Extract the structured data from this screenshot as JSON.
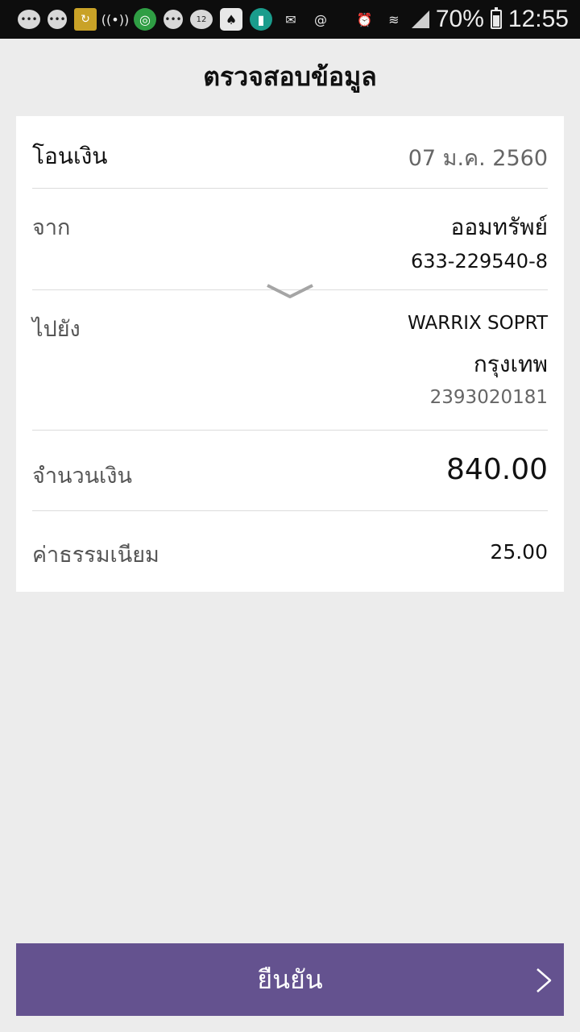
{
  "status_bar": {
    "icons": [
      "chat-icon",
      "chat-bubble-icon",
      "refresh-app-icon",
      "wifi-hotspot-icon",
      "compass-app-icon",
      "message-icon",
      "calendar-icon",
      "hat-app-icon",
      "trash-app-icon",
      "gmail-icon",
      "at-mail-icon",
      "alarm-icon",
      "wifi-icon",
      "signal-icon"
    ],
    "battery_percent": "70%",
    "battery_level": 0.7,
    "time": "12:55"
  },
  "header": {
    "title": "ตรวจสอบข้อมูล"
  },
  "transfer": {
    "type_label": "โอนเงิน",
    "date": "07 ม.ค. 2560"
  },
  "from": {
    "label": "จาก",
    "account_name": "ออมทรัพย์",
    "account_number": "633-229540-8"
  },
  "to": {
    "label": "ไปยัง",
    "name": "WARRIX SOPRT",
    "bank": "กรุงเทพ",
    "account_number": "2393020181"
  },
  "amount": {
    "label": "จำนวนเงิน",
    "value": "840.00"
  },
  "fee": {
    "label": "ค่าธรรมเนียม",
    "value": "25.00"
  },
  "confirm": {
    "label": "ยืนยัน"
  },
  "colors": {
    "status_bar": "#0d0d0d",
    "background": "#ececec",
    "card": "#ffffff",
    "confirm_button": "#64528f"
  }
}
